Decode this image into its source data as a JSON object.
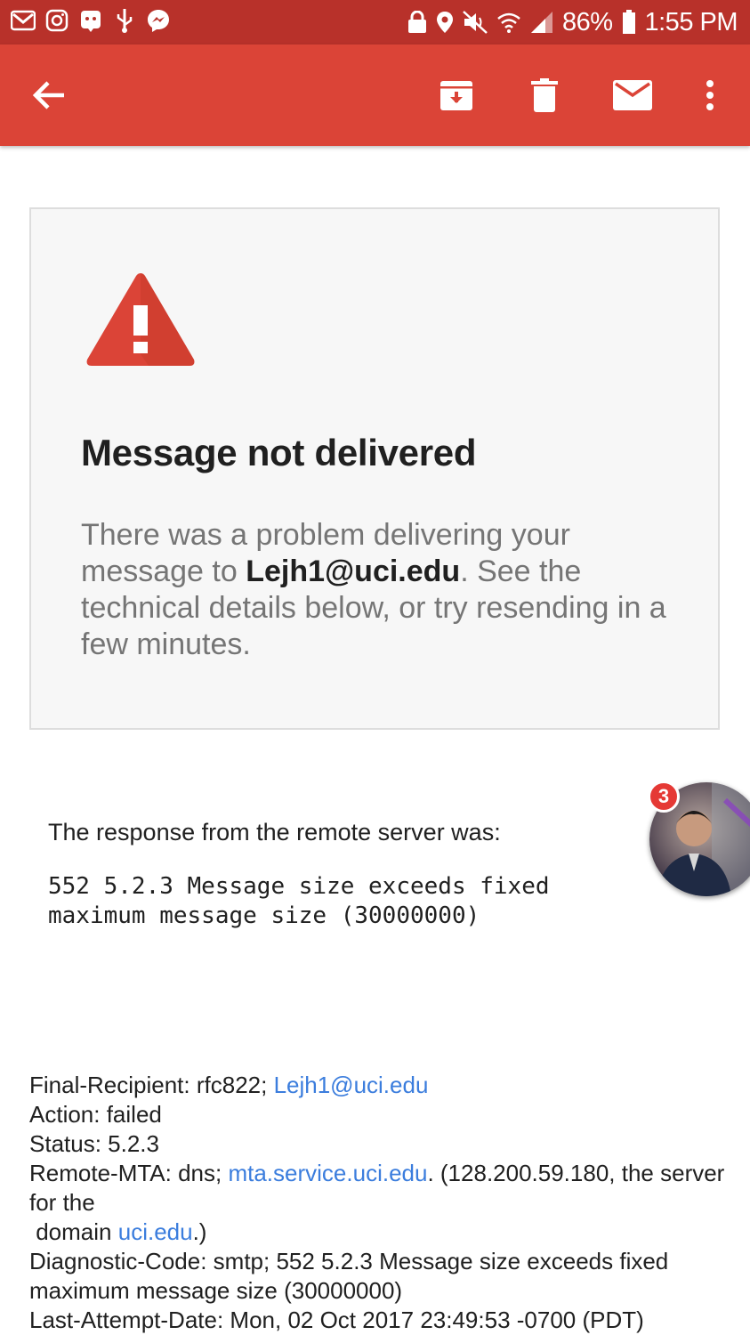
{
  "status_bar": {
    "battery": "86%",
    "time": "1:55 PM"
  },
  "app_bar": {
    "icons": [
      "back-arrow-icon",
      "archive-icon",
      "delete-icon",
      "mail-icon",
      "more-vert-icon"
    ]
  },
  "card": {
    "title": "Message not delivered",
    "desc_before": "There was a problem delivering your message to ",
    "recipient": "Lejh1@uci.edu",
    "desc_after": ". See the technical details below, or try resending in a few minutes."
  },
  "response": {
    "label": "The response from the remote server was:",
    "code": "552 5.2.3 Message size exceeds fixed maximum message size (30000000)"
  },
  "chat_head": {
    "badge_count": "3"
  },
  "details": {
    "final_recipient_prefix": "Final-Recipient: rfc822; ",
    "final_recipient_link": "Lejh1@uci.edu",
    "action": "Action: failed",
    "status": "Status: 5.2.3",
    "remote_mta_prefix": "Remote-MTA: dns; ",
    "remote_mta_link": "mta.service.uci.edu",
    "remote_mta_suffix": ". (128.200.59.180, the server for the",
    "domain_prefix": " domain ",
    "domain_link": "uci.edu",
    "domain_suffix": ".)",
    "diagnostic_code": "Diagnostic-Code: smtp; 552 5.2.3 Message size exceeds fixed maximum message size (30000000)",
    "last_attempt": "Last-Attempt-Date: Mon, 02 Oct 2017 23:49:53 -0700 (PDT)"
  },
  "colors": {
    "status_bar": "#b8312a",
    "app_bar": "#db4437",
    "warning": "#db4437",
    "link": "#3b7ddd"
  }
}
